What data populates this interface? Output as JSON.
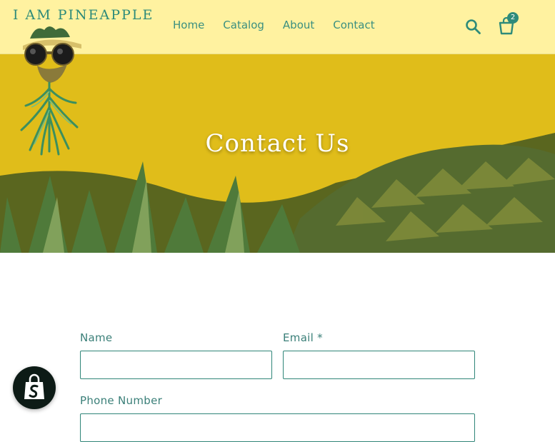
{
  "header": {
    "brand": "I AM PINEAPPLE",
    "nav": [
      {
        "label": "Home"
      },
      {
        "label": "Catalog"
      },
      {
        "label": "About"
      },
      {
        "label": "Contact"
      }
    ],
    "cart_count": "2"
  },
  "hero": {
    "title": "Contact Us"
  },
  "form": {
    "name_label": "Name",
    "email_label": "Email *",
    "phone_label": "Phone Number"
  },
  "colors": {
    "header_bg": "#fff2a0",
    "accent": "#2e8b7a",
    "hero_bg": "#e2bf19"
  },
  "icons": [
    "pineapple-logo-icon",
    "search-icon",
    "cart-icon",
    "shopify-bag-icon"
  ]
}
